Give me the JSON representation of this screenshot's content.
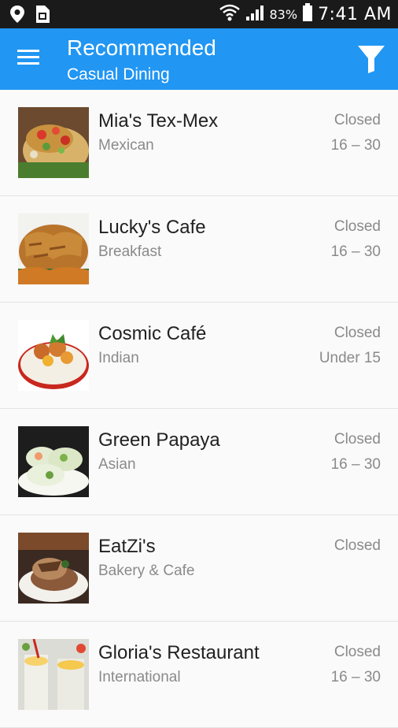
{
  "status_bar": {
    "battery_percent": "83%",
    "time": "7:41 AM",
    "icons": [
      "location-icon",
      "sim-card-icon",
      "wifi-icon",
      "signal-icon",
      "battery-icon"
    ]
  },
  "app_bar": {
    "title": "Recommended",
    "subtitle": "Casual Dining",
    "background_color": "#2196f3",
    "icons": [
      "menu-icon",
      "filter-icon"
    ]
  },
  "restaurants": [
    {
      "name": "Mia's Tex-Mex",
      "cuisine": "Mexican",
      "status": "Closed",
      "price": "16 – 30"
    },
    {
      "name": "Lucky's Cafe",
      "cuisine": "Breakfast",
      "status": "Closed",
      "price": "16 – 30"
    },
    {
      "name": "Cosmic Café",
      "cuisine": "Indian",
      "status": "Closed",
      "price": "Under 15"
    },
    {
      "name": "Green Papaya",
      "cuisine": "Asian",
      "status": "Closed",
      "price": "16 – 30"
    },
    {
      "name": "EatZi's",
      "cuisine": "Bakery & Cafe",
      "status": "Closed",
      "price": ""
    },
    {
      "name": "Gloria's Restaurant",
      "cuisine": "International",
      "status": "Closed",
      "price": "16 – 30"
    }
  ]
}
